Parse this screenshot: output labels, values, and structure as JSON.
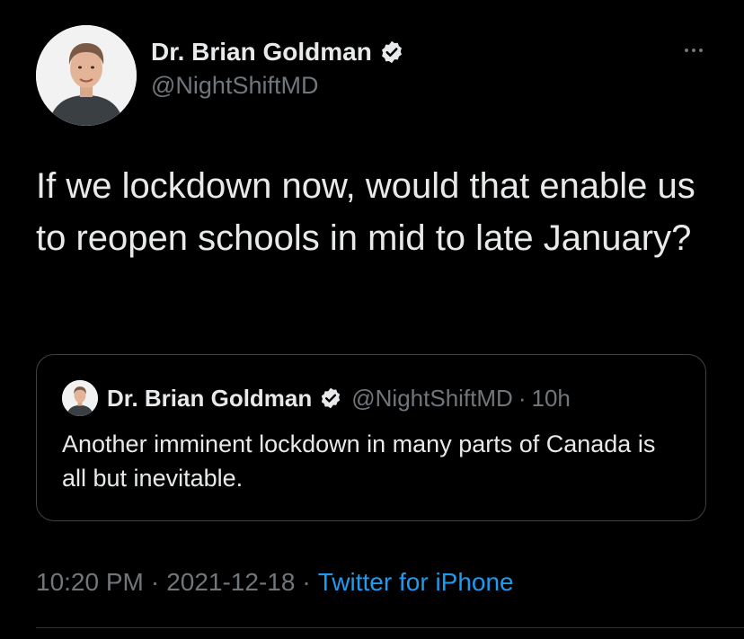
{
  "tweet": {
    "author": {
      "name": "Dr. Brian Goldman",
      "handle": "@NightShiftMD",
      "verified": true,
      "avatar_icon": "profile-photo-icon"
    },
    "more_icon": "more-horizontal-icon",
    "text": "If we lockdown now, would that enable us to reopen schools in mid to late January?",
    "quoted": {
      "author_name": "Dr. Brian Goldman",
      "handle": "@NightShiftMD",
      "separator": "·",
      "time": "10h",
      "verified": true,
      "text": "Another imminent lockdown in many parts of Canada is all but inevitable."
    },
    "meta": {
      "time": "10:20 PM",
      "separator": "·",
      "date": "2021-12-18",
      "source": "Twitter for iPhone"
    }
  },
  "colors": {
    "background": "#000000",
    "text_primary": "#e7e9ea",
    "text_secondary": "#71767b",
    "link": "#1d9bf0",
    "border": "#3e4144"
  }
}
